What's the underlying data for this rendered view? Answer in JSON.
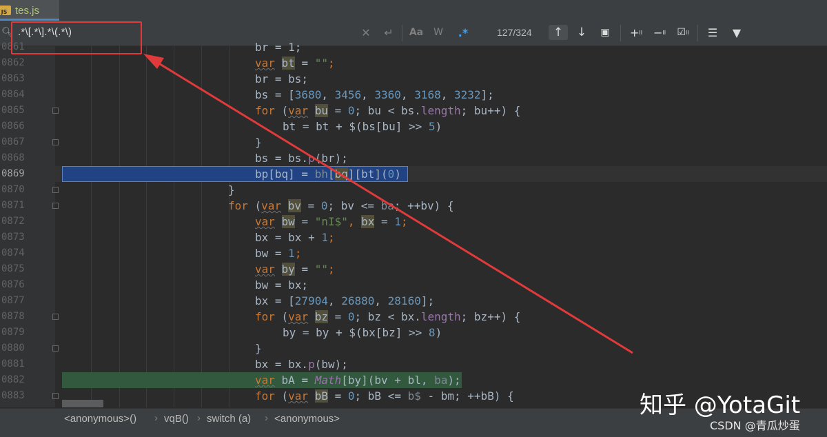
{
  "tab": {
    "icon": "JS",
    "filename": "tes.js"
  },
  "search": {
    "query": ".*\\[.*\\].*\\(.*\\)",
    "match_count": "127/324",
    "options": {
      "match_case": "Aa",
      "words": "W",
      "regex": ".*"
    }
  },
  "lines": [
    {
      "num": "0861"
    },
    {
      "num": "0862"
    },
    {
      "num": "0863"
    },
    {
      "num": "0864"
    },
    {
      "num": "0865"
    },
    {
      "num": "0866"
    },
    {
      "num": "0867"
    },
    {
      "num": "0868"
    },
    {
      "num": "0869"
    },
    {
      "num": "0870"
    },
    {
      "num": "0871"
    },
    {
      "num": "0872"
    },
    {
      "num": "0873"
    },
    {
      "num": "0874"
    },
    {
      "num": "0875"
    },
    {
      "num": "0876"
    },
    {
      "num": "0877"
    },
    {
      "num": "0878"
    },
    {
      "num": "0879"
    },
    {
      "num": "0880"
    },
    {
      "num": "0881"
    },
    {
      "num": "0882"
    },
    {
      "num": "0883"
    }
  ],
  "code": {
    "l861": "br = 1;",
    "l862a": "var",
    "l862b": " ",
    "l862c": "bt",
    "l862d": " = ",
    "l862e": "\"\"",
    "l862f": ";",
    "l863": "br = bs;",
    "l864a": "bs = [",
    "l864b": "3680",
    "l864c": ", ",
    "l864d": "3456",
    "l864e": ", ",
    "l864f": "3360",
    "l864g": ", ",
    "l864h": "3168",
    "l864i": ", ",
    "l864j": "3232",
    "l864k": "];",
    "l865a": "for",
    "l865b": " (",
    "l865c": "var",
    "l865d": " ",
    "l865e": "bu",
    "l865f": " = ",
    "l865g": "0",
    "l865h": "; bu < bs.",
    "l865i": "length",
    "l865j": "; bu++) {",
    "l866a": "bt = bt + $(bs[bu] >> ",
    "l866b": "5",
    "l866c": ")",
    "l867": "}",
    "l868a": "bs = bs.",
    "l868b": "p",
    "l868c": "(br);",
    "l869a": "bp[bq] = ",
    "l869b": "bh",
    "l869c": "[",
    "l869d": "bq",
    "l869e": "][bt](",
    "l869f": "0",
    "l869g": ")",
    "l870": "}",
    "l871a": "for",
    "l871b": " (",
    "l871c": "var",
    "l871d": " ",
    "l871e": "bv",
    "l871f": " = ",
    "l871g": "0",
    "l871h": "; bv <= ",
    "l871i": "ba",
    "l871j": "; ++bv) {",
    "l872a": "var",
    "l872b": " ",
    "l872c": "bw",
    "l872d": " = ",
    "l872e": "\"nI$\"",
    "l872f": ", ",
    "l872g": "bx",
    "l872h": " = ",
    "l872i": "1",
    "l872j": ";",
    "l873a": "bx = bx + ",
    "l873b": "1",
    "l873c": ";",
    "l874a": "bw = ",
    "l874b": "1",
    "l874c": ";",
    "l875a": "var",
    "l875b": " ",
    "l875c": "by",
    "l875d": " = ",
    "l875e": "\"\"",
    "l875f": ";",
    "l876": "bw = bx;",
    "l877a": "bx = [",
    "l877b": "27904",
    "l877c": ", ",
    "l877d": "26880",
    "l877e": ", ",
    "l877f": "28160",
    "l877g": "];",
    "l878a": "for",
    "l878b": " (",
    "l878c": "var",
    "l878d": " ",
    "l878e": "bz",
    "l878f": " = ",
    "l878g": "0",
    "l878h": "; bz < bx.",
    "l878i": "length",
    "l878j": "; bz++) {",
    "l879a": "by = by + $(bx[bz] >> ",
    "l879b": "8",
    "l879c": ")",
    "l880": "}",
    "l881a": "bx = bx.",
    "l881b": "p",
    "l881c": "(bw);",
    "l882a": "var",
    "l882b": " bA = ",
    "l882c": "Math",
    "l882d": "[by](bv + bl, ",
    "l882e": "ba",
    "l882f": ");",
    "l883a": "for",
    "l883b": " (",
    "l883c": "var",
    "l883d": " ",
    "l883e": "bB",
    "l883f": " = ",
    "l883g": "0",
    "l883h": "; bB <= ",
    "l883i": "b$",
    "l883j": " - bm; ++bB) {"
  },
  "breadcrumb": [
    "<anonymous>()",
    "vqB()",
    "switch (a)",
    "<anonymous>"
  ],
  "watermark": {
    "zhihu": "知乎 @YotaGit",
    "csdn": "CSDN @青瓜炒蛋"
  },
  "colors": {
    "annotation": "#e03a3a",
    "selection": "#214283",
    "match": "#32593d",
    "keyword": "#cc7832",
    "number": "#6897bb",
    "string": "#6a8759"
  }
}
